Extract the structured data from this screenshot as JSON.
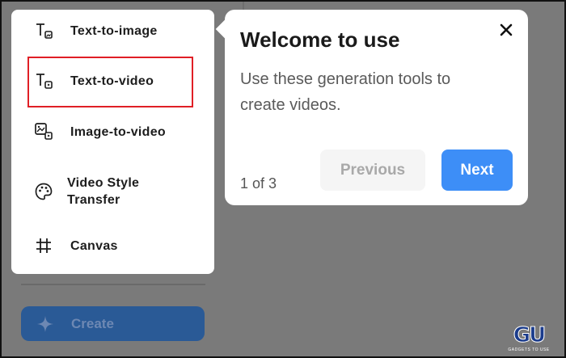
{
  "sidebar": {
    "create_label": "Create",
    "items": [
      {
        "label": "Text-to-image",
        "icon": "text-image-icon"
      },
      {
        "label": "Text-to-video",
        "icon": "text-video-icon"
      },
      {
        "label": "Image-to-video",
        "icon": "image-video-icon"
      },
      {
        "label": "Video Style Transfer",
        "icon": "palette-icon"
      },
      {
        "label": "Canvas",
        "icon": "canvas-frame-icon"
      }
    ]
  },
  "popover": {
    "title": "Welcome to use",
    "body": "Use these generation tools to create videos.",
    "counter": "1 of 3",
    "previous_label": "Previous",
    "next_label": "Next"
  },
  "watermark": {
    "logo": "GU",
    "text": "GADGETS TO USE"
  },
  "colors": {
    "highlight_border": "#e01f26",
    "next_button": "#3d8ef7",
    "create_button": "#2a5a96",
    "overlay": "#7a7a7a"
  }
}
